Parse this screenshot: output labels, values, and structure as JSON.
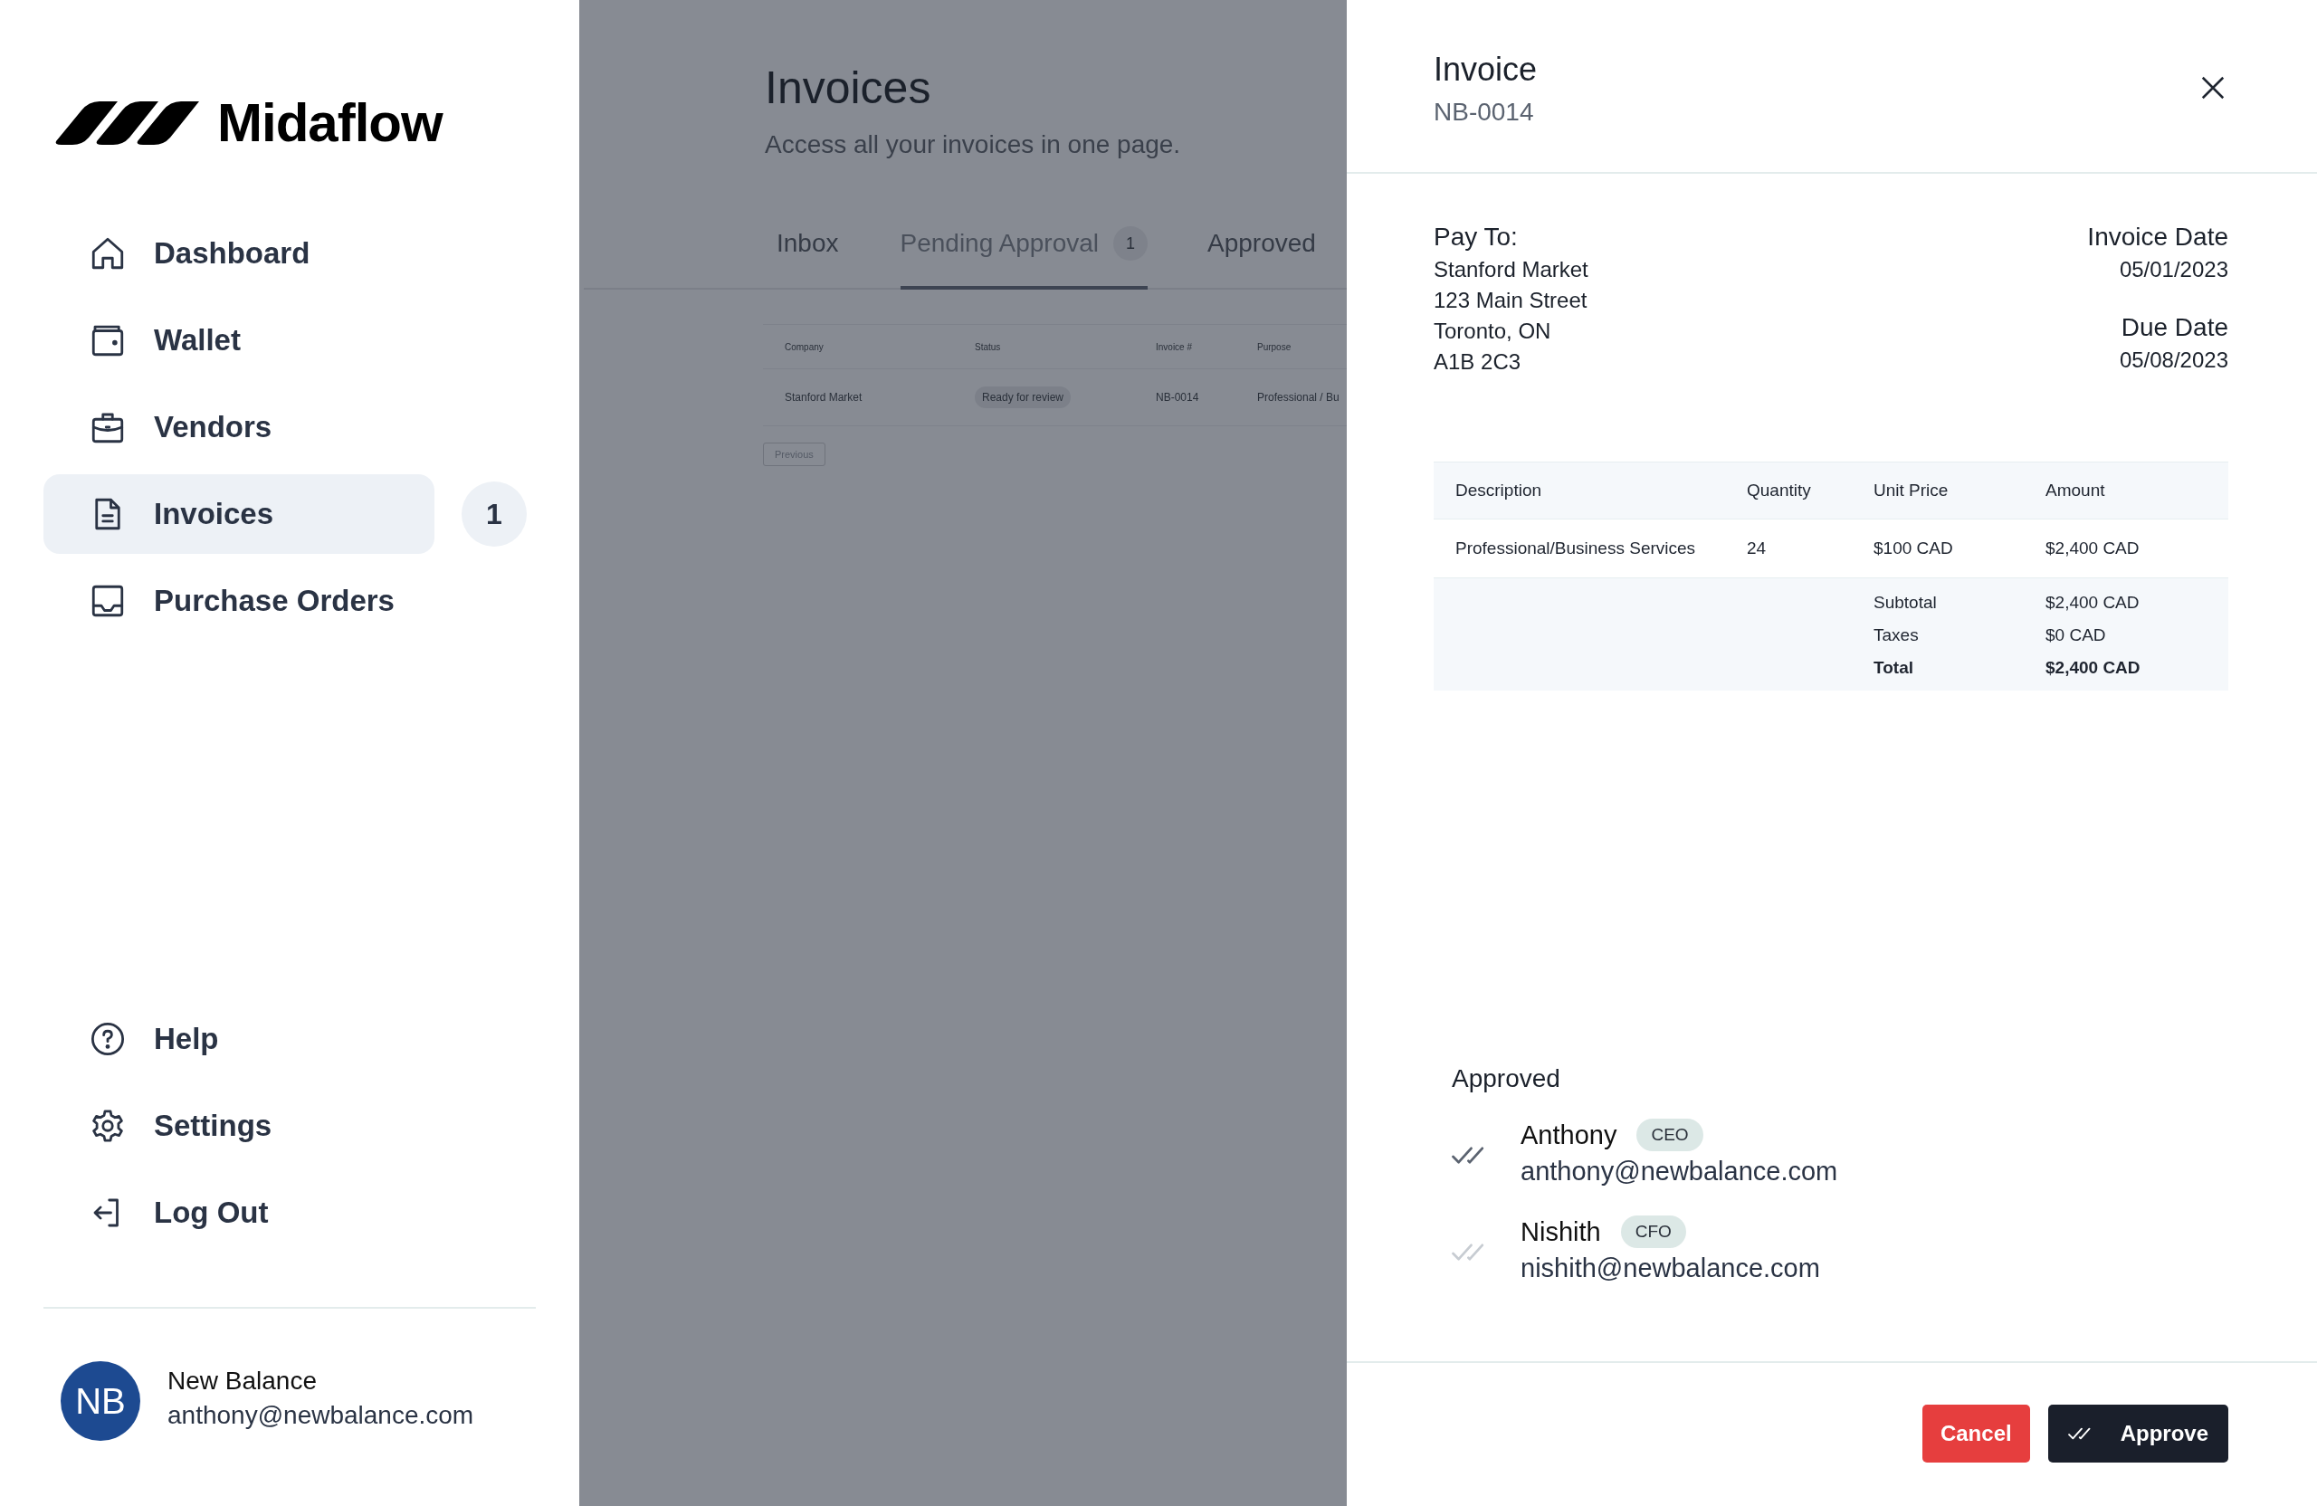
{
  "sidebar": {
    "logo": "Midaflow",
    "nav": [
      {
        "label": "Dashboard",
        "selected": false
      },
      {
        "label": "Wallet",
        "selected": false
      },
      {
        "label": "Vendors",
        "selected": false
      },
      {
        "label": "Invoices",
        "selected": true,
        "count": "1"
      },
      {
        "label": "Purchase Orders",
        "selected": false
      }
    ],
    "footer_nav": [
      {
        "label": "Help"
      },
      {
        "label": "Settings"
      },
      {
        "label": "Log Out"
      }
    ],
    "profile": {
      "initials": "NB",
      "name": "New Balance",
      "email": "anthony@newbalance.com"
    }
  },
  "page": {
    "title": "Invoices",
    "subtitle": "Access all your invoices in one page.",
    "tabs": [
      {
        "label": "Inbox",
        "selected": false
      },
      {
        "label": "Pending Approval",
        "selected": true,
        "count": "1"
      },
      {
        "label": "Approved",
        "selected": false
      }
    ],
    "table": {
      "columns": [
        "Company",
        "Status",
        "Invoice #",
        "Purpose"
      ],
      "rows": [
        {
          "company": "Stanford Market",
          "status": "Ready for review",
          "invoice_number": "NB-0014",
          "purpose": "Professional / Bu"
        }
      ]
    },
    "previous": "Previous"
  },
  "panel": {
    "title": "Invoice",
    "number": "NB-0014",
    "pay_to": {
      "label": "Pay To:",
      "lines": [
        "Stanford Market",
        "123 Main Street",
        "Toronto, ON",
        "A1B 2C3"
      ]
    },
    "dates": [
      {
        "label": "Invoice Date",
        "value": "05/01/2023"
      },
      {
        "label": "Due Date",
        "value": "05/08/2023"
      }
    ],
    "items": {
      "columns": [
        "Description",
        "Quantity",
        "Unit Price",
        "Amount"
      ],
      "rows": [
        [
          "Professional/Business Services",
          "24",
          "$100 CAD",
          "$2,400 CAD"
        ]
      ],
      "summary": [
        {
          "label": "Subtotal",
          "value": "$2,400 CAD",
          "bold": false
        },
        {
          "label": "Taxes",
          "value": "$0 CAD",
          "bold": false
        },
        {
          "label": "Total",
          "value": "$2,400 CAD",
          "bold": true
        }
      ]
    },
    "approvals": {
      "title": "Approved",
      "approvers": [
        {
          "name": "Anthony",
          "role": "CEO",
          "email": "anthony@newbalance.com",
          "approved": true
        },
        {
          "name": "Nishith",
          "role": "CFO",
          "email": "nishith@newbalance.com",
          "approved": false
        }
      ]
    },
    "actions": [
      {
        "label": "Cancel",
        "kind": "danger"
      },
      {
        "label": "Approve",
        "kind": "primary"
      }
    ]
  }
}
